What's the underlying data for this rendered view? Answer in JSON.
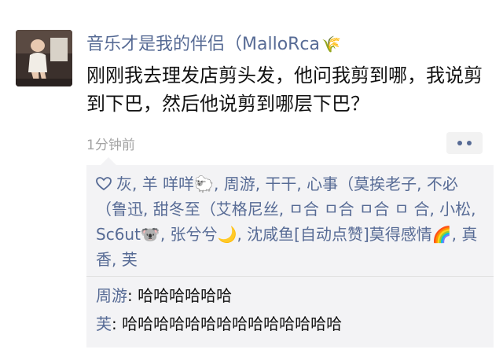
{
  "post": {
    "author": "音乐才是我的伴侣（MalloRca",
    "author_emoji": "🌾",
    "text": "刚刚我去理发店剪头发，他问我剪到哪，我说剪到下巴，然后他说剪到哪层下巴？",
    "timestamp": "1分钟前"
  },
  "likes": {
    "text": "灰, 羊 咩咩🐑, 周游, 干干, 心事（莫挨老子, 不必（鲁迅, 甜冬至（艾格尼丝, ㅁ合 ㅁ合 ㅁ合 ㅁ 合, 小松, Sc6ut🐨, 张兮兮🌙, 沈咸鱼[自动点赞]莫得感情🌈, 真香, 芙"
  },
  "comments": [
    {
      "author": "周游",
      "separator": ": ",
      "text": "哈哈哈哈哈哈"
    },
    {
      "author": "芙",
      "separator": ": ",
      "text": "哈哈哈哈哈哈哈哈哈哈哈哈哈哈"
    }
  ],
  "colors": {
    "link": "#576b95",
    "timestamp": "#a3a3a3",
    "comment_bg": "#f3f3f5"
  }
}
